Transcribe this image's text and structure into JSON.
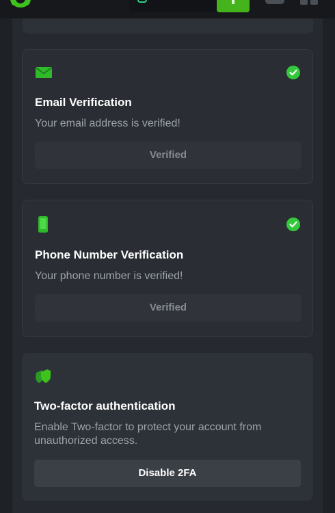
{
  "colors": {
    "accent_green": "#45b31b",
    "check_green": "#34c93a",
    "background": "#1e2126",
    "card": "#2d3138"
  },
  "header": {
    "logo_icon": "brand-logo-icon",
    "deposit_icon": "plus-icon"
  },
  "email_card": {
    "icon": "envelope-icon",
    "status_icon": "check-circle-icon",
    "title": "Email Verification",
    "description": "Your email address is verified!",
    "button_label": "Verified"
  },
  "phone_card": {
    "icon": "phone-icon",
    "status_icon": "check-circle-icon",
    "title": "Phone Number Verification",
    "description": "Your phone number is verified!",
    "button_label": "Verified"
  },
  "twofa_card": {
    "icon": "shield-icon",
    "title": "Two-factor authentication",
    "description": "Enable Two-factor to protect your account from unauthorized access.",
    "button_label": "Disable 2FA"
  }
}
